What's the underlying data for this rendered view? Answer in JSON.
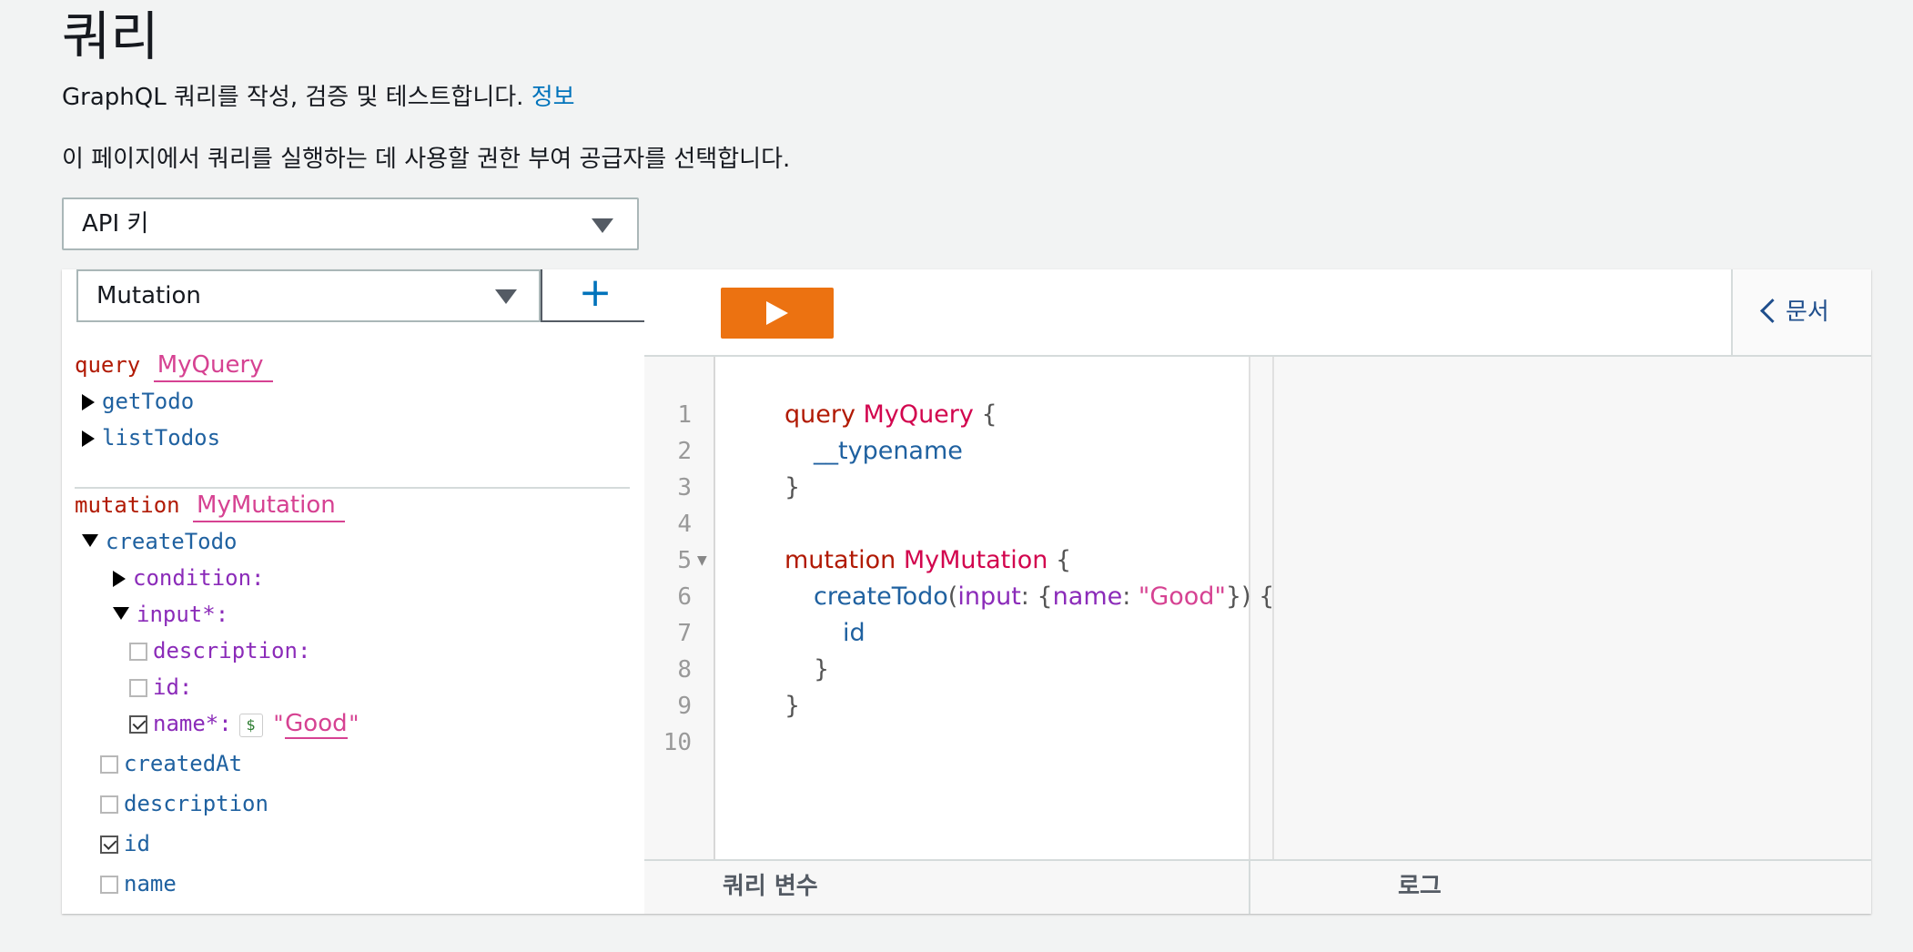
{
  "page": {
    "title": "쿼리",
    "subtitle": "GraphQL 쿼리를 작성, 검증 및 테스트합니다.",
    "info_link": "정보",
    "auth_prompt": "이 페이지에서 쿼리를 실행하는 데 사용할 권한 부여 공급자를 선택합니다.",
    "auth_selected": "API 키"
  },
  "explorer": {
    "operation_type": "Mutation",
    "add_label": "+",
    "query": {
      "keyword": "query",
      "name": "MyQuery",
      "fields": [
        "getTodo",
        "listTodos"
      ]
    },
    "mutation": {
      "keyword": "mutation",
      "name": "MyMutation",
      "field": "createTodo",
      "args": {
        "condition": "condition:",
        "input": "input*:",
        "input_fields": [
          "description:",
          "id:"
        ],
        "name_field": "name*:",
        "var_badge": "$",
        "quote_open": "\"",
        "name_value": "Good",
        "quote_close": "\""
      },
      "return_fields": [
        {
          "label": "createdAt",
          "checked": false
        },
        {
          "label": "description",
          "checked": false
        },
        {
          "label": "id",
          "checked": true
        },
        {
          "label": "name",
          "checked": false
        }
      ]
    }
  },
  "toolbar": {
    "docs_label": "문서"
  },
  "editor": {
    "line_numbers": [
      "1",
      "2",
      "3",
      "4",
      "5",
      "6",
      "7",
      "8",
      "9",
      "10"
    ],
    "code": {
      "l1_kw": "query",
      "l1_name": "MyQuery",
      "l1_brace": " {",
      "l2_field": "__typename",
      "l3": "}",
      "l5_kw": "mutation",
      "l5_name": "MyMutation",
      "l5_brace": " {",
      "l6_field": "createTodo",
      "l6_p1": "(",
      "l6_arg": "input",
      "l6_p2": ": {",
      "l6_key": "name",
      "l6_p3": ": ",
      "l6_str": "\"Good\"",
      "l6_p4": "}) {",
      "l7_field": "id",
      "l8": "}",
      "l9": "}"
    }
  },
  "bottom": {
    "vars_label": "쿼리 변수",
    "logs_label": "로그"
  }
}
